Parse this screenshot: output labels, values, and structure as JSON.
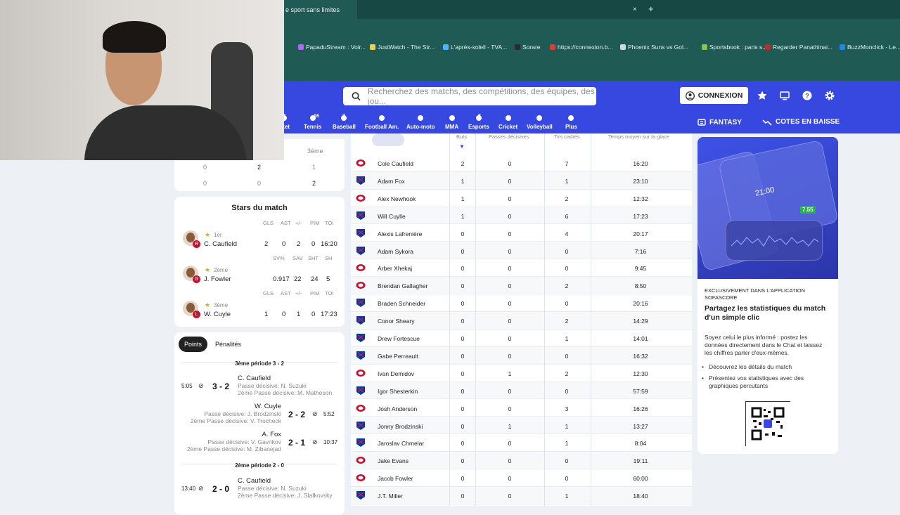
{
  "browser": {
    "tab_title": "e sport sans limites",
    "tab_close": "×",
    "tab_new": "+",
    "bookmarks": [
      {
        "label": "PapaduStream : Voir...",
        "color": "#b366f0"
      },
      {
        "label": "JustWatch - The Str...",
        "color": "#f5d142"
      },
      {
        "label": "L'après-soleil - TVA...",
        "color": "#49b6ff"
      },
      {
        "label": "Sorare",
        "color": "#2b2b2b"
      },
      {
        "label": "https://connexion.b...",
        "color": "#e53935"
      },
      {
        "label": "Phoenix Suns vs Gol...",
        "color": "#cfd8dc"
      },
      {
        "label": "Sportsbook : paris s...",
        "color": "#8bc34a"
      },
      {
        "label": "Regarder Panathinai...",
        "color": "#c62828"
      },
      {
        "label": "BuzzMonclick - Le...",
        "color": "#1e88e5"
      }
    ]
  },
  "header": {
    "search_placeholder": "Recherchez des matchs, des compétitions, des équipes, des jou...",
    "login_label": "CONNEXION",
    "sports": [
      {
        "label": "sket",
        "count": "7"
      },
      {
        "label": "Tennis",
        "count": "16"
      },
      {
        "label": "Baseball",
        "count": "2"
      },
      {
        "label": "Football Am.",
        "count": ""
      },
      {
        "label": "Auto-moto",
        "count": ""
      },
      {
        "label": "MMA",
        "count": ""
      },
      {
        "label": "Esports",
        "count": "8"
      },
      {
        "label": "Cricket",
        "count": ""
      },
      {
        "label": "Volleyball",
        "count": ""
      },
      {
        "label": "Plus",
        "count": ""
      }
    ],
    "fantasy_label": "FANTASY",
    "odds_label": "COTES EN BAISSE"
  },
  "period_card": {
    "header_3": "3ème",
    "rows": [
      [
        "0",
        "2",
        "1"
      ],
      [
        "0",
        "0",
        "2"
      ]
    ]
  },
  "stars": {
    "title": "Stars du match",
    "players": [
      {
        "rank": "1er",
        "name": "C. Caufield",
        "cols": [
          "GLS",
          "AST",
          "+/-",
          "PIM",
          "TOI"
        ],
        "values": [
          "2",
          "0",
          "2",
          "0",
          "16:20"
        ],
        "badge": "R"
      },
      {
        "rank": "2ème",
        "name": "J. Fowler",
        "cols": [
          "SV%",
          "SAV",
          "SHT",
          "SH"
        ],
        "values": [
          "0.917",
          "22",
          "24",
          "5"
        ],
        "badge": "G"
      },
      {
        "rank": "3ème",
        "name": "W. Cuyle",
        "cols": [
          "GLS",
          "AST",
          "+/-",
          "PIM",
          "TOI"
        ],
        "values": [
          "1",
          "0",
          "1",
          "0",
          "17:23"
        ],
        "badge": "L"
      }
    ]
  },
  "goals": {
    "tab_points": "Points",
    "tab_penalties": "Pénalités",
    "period3_title": "3ème période 3 - 2",
    "period2_title": "2ème période 2 - 0",
    "events": [
      {
        "time": "5:05",
        "score": "3 - 2",
        "scorer": "C. Caufield",
        "assist1": "Passe décisive: N. Suzuki",
        "assist2": "2ème Passe décisive: M. Matheson",
        "side": "left"
      },
      {
        "time": "5:52",
        "score": "2 - 2",
        "scorer": "W. Cuyle",
        "assist1": "Passe décisive: J. Brodzinski",
        "assist2": "2ème Passe décisive: V. Trocheck",
        "side": "right"
      },
      {
        "time": "10:37",
        "score": "2 - 1",
        "scorer": "A. Fox",
        "assist1": "Passe décisive: V. Gavrikov",
        "assist2": "2ème Passe décisive: M. Zibanejad",
        "side": "right"
      },
      {
        "time": "13:40",
        "score": "2 - 0",
        "scorer": "C. Caufield",
        "assist1": "Passe décisive: N. Suzuki",
        "assist2": "2ème Passe décisive: J. Slafkovsky",
        "side": "left"
      }
    ]
  },
  "table": {
    "columns": [
      "Buts",
      "Passes décisives",
      "Tirs cadrés",
      "Temps moyen sur la glace"
    ],
    "rows": [
      {
        "team": "MTL",
        "name": "Cole Caufield",
        "goals": "2",
        "assists": "0",
        "shots": "7",
        "toi": "16:20"
      },
      {
        "team": "NYR",
        "name": "Adam Fox",
        "goals": "1",
        "assists": "0",
        "shots": "1",
        "toi": "23:10"
      },
      {
        "team": "MTL",
        "name": "Alex Newhook",
        "goals": "1",
        "assists": "0",
        "shots": "2",
        "toi": "12:32"
      },
      {
        "team": "NYR",
        "name": "Will Cuylle",
        "goals": "1",
        "assists": "0",
        "shots": "6",
        "toi": "17:23"
      },
      {
        "team": "NYR",
        "name": "Alexis Lafrenière",
        "goals": "0",
        "assists": "0",
        "shots": "4",
        "toi": "20:17"
      },
      {
        "team": "NYR",
        "name": "Adam Sykora",
        "goals": "0",
        "assists": "0",
        "shots": "0",
        "toi": "7:16"
      },
      {
        "team": "MTL",
        "name": "Arber Xhekaj",
        "goals": "0",
        "assists": "0",
        "shots": "0",
        "toi": "9:45"
      },
      {
        "team": "MTL",
        "name": "Brendan Gallagher",
        "goals": "0",
        "assists": "0",
        "shots": "2",
        "toi": "8:50"
      },
      {
        "team": "NYR",
        "name": "Braden Schneider",
        "goals": "0",
        "assists": "0",
        "shots": "0",
        "toi": "20:16"
      },
      {
        "team": "NYR",
        "name": "Conor Sheary",
        "goals": "0",
        "assists": "0",
        "shots": "2",
        "toi": "14:29"
      },
      {
        "team": "NYR",
        "name": "Drew Fortescue",
        "goals": "0",
        "assists": "0",
        "shots": "1",
        "toi": "14:01"
      },
      {
        "team": "NYR",
        "name": "Gabe Perreault",
        "goals": "0",
        "assists": "0",
        "shots": "0",
        "toi": "16:32"
      },
      {
        "team": "MTL",
        "name": "Ivan Demidov",
        "goals": "0",
        "assists": "1",
        "shots": "2",
        "toi": "12:30"
      },
      {
        "team": "NYR",
        "name": "Igor Shesterkin",
        "goals": "0",
        "assists": "0",
        "shots": "0",
        "toi": "57:59"
      },
      {
        "team": "MTL",
        "name": "Josh Anderson",
        "goals": "0",
        "assists": "0",
        "shots": "3",
        "toi": "16:26"
      },
      {
        "team": "NYR",
        "name": "Jonny Brodzinski",
        "goals": "0",
        "assists": "1",
        "shots": "1",
        "toi": "13:27"
      },
      {
        "team": "NYR",
        "name": "Jaroslav Chmelar",
        "goals": "0",
        "assists": "0",
        "shots": "1",
        "toi": "8:04"
      },
      {
        "team": "MTL",
        "name": "Jake Evans",
        "goals": "0",
        "assists": "0",
        "shots": "0",
        "toi": "19:11"
      },
      {
        "team": "MTL",
        "name": "Jacob Fowler",
        "goals": "0",
        "assists": "0",
        "shots": "0",
        "toi": "60:00"
      },
      {
        "team": "NYR",
        "name": "J.T. Miller",
        "goals": "0",
        "assists": "0",
        "shots": "1",
        "toi": "18:40"
      }
    ]
  },
  "promo": {
    "kicker": "EXCLUSIVEMENT DANS L'APPLICATION SOFASCORE",
    "title": "Partagez les statistiques du match d'un simple clic",
    "body": "Soyez celui le plus informé : postez les données directement dans le Chat et laissez les chiffres parler d'eux-mêmes.",
    "bullets": [
      "Découvrez les détails du match",
      "Présentez vos statistiques avec des graphiques percutants"
    ],
    "phone_time": "21:00",
    "phone_rating": "7.55"
  },
  "colors": {
    "brand": "#3748e0",
    "mtl": "#c8102e",
    "nyr": "#0038a8"
  }
}
